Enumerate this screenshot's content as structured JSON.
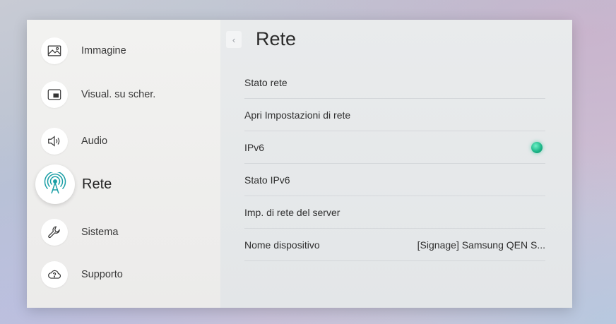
{
  "sidebar": {
    "items": [
      {
        "label": "Immagine",
        "icon": "picture-icon"
      },
      {
        "label": "Visual. su scher.",
        "icon": "screen-display-icon"
      },
      {
        "label": "Audio",
        "icon": "speaker-icon"
      },
      {
        "label": "Rete",
        "icon": "network-antenna-icon",
        "active": true
      },
      {
        "label": "Sistema",
        "icon": "wrench-icon"
      },
      {
        "label": "Supporto",
        "icon": "support-cloud-icon"
      }
    ]
  },
  "main": {
    "title": "Rete",
    "back_icon": "chevron-left-icon",
    "rows": [
      {
        "label": "Stato rete"
      },
      {
        "label": "Apri Impostazioni di rete"
      },
      {
        "label": "IPv6",
        "toggle_on": true
      },
      {
        "label": "Stato IPv6"
      },
      {
        "label": "Imp. di rete del server"
      },
      {
        "label": "Nome dispositivo",
        "value": "[Signage] Samsung QEN S..."
      }
    ]
  },
  "colors": {
    "toggle_on": "#1fb88a",
    "sidebar_bg": "#f2f2f0",
    "main_bg": "#e6e8ea"
  }
}
